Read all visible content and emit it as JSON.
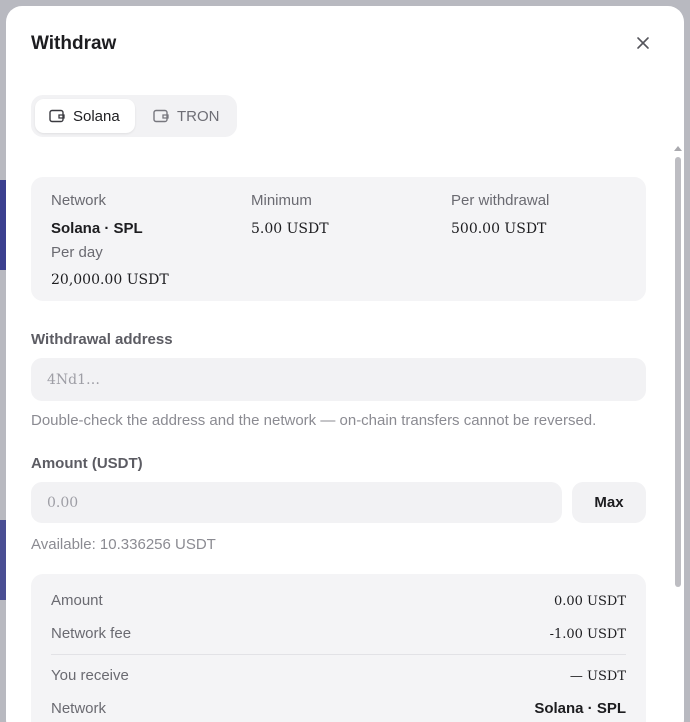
{
  "modal": {
    "title": "Withdraw"
  },
  "tabs": [
    {
      "label": "Solana",
      "icon": "wallet-icon",
      "active": true
    },
    {
      "label": "TRON",
      "icon": "wallet-icon",
      "active": false
    }
  ],
  "info": {
    "network_label": "Network",
    "network_value": "Solana · SPL",
    "minimum_label": "Minimum",
    "minimum_value": "5.00 USDT",
    "per_withdrawal_label": "Per withdrawal",
    "per_withdrawal_value": "500.00 USDT",
    "per_day_label": "Per day",
    "per_day_value": "20,000.00 USDT"
  },
  "address": {
    "label": "Withdrawal address",
    "placeholder": "4Nd1…",
    "hint": "Double-check the address and the network — on-chain transfers cannot be reversed."
  },
  "amount": {
    "label": "Amount (USDT)",
    "placeholder": "0.00",
    "max_label": "Max",
    "available": "Available: 10.336256 USDT"
  },
  "summary": {
    "amount_label": "Amount",
    "amount_value": "0.00 USDT",
    "fee_label": "Network fee",
    "fee_value": "-1.00 USDT",
    "receive_label": "You receive",
    "receive_value": "— USDT",
    "network_label": "Network",
    "network_value": "Solana · SPL"
  },
  "colors": {
    "backdrop": "#b8b9c0",
    "card": "#f4f4f6",
    "text": "#1d1d20",
    "muted": "#6a6a71"
  }
}
